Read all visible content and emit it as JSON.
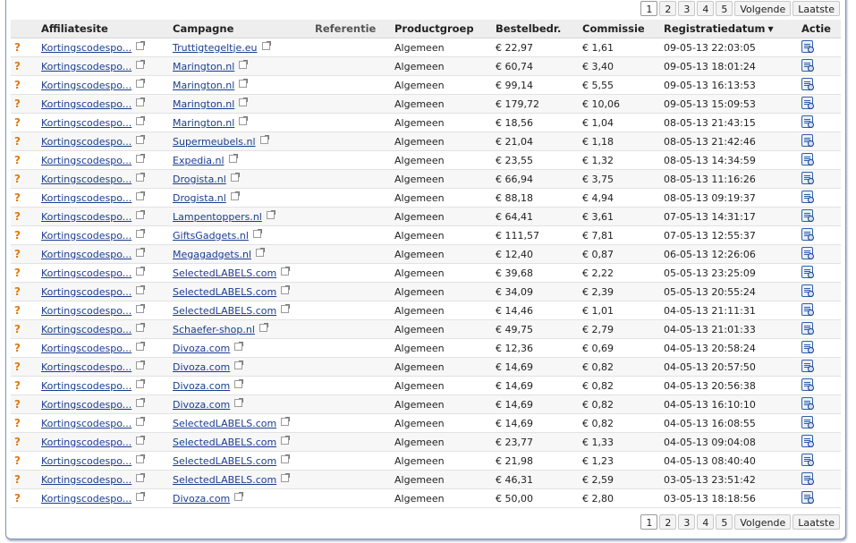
{
  "pager": {
    "pages": [
      "1",
      "2",
      "3",
      "4",
      "5"
    ],
    "active": "1",
    "next_label": "Volgende",
    "last_label": "Laatste"
  },
  "columns": {
    "affiliatesite": "Affiliatesite",
    "campagne": "Campagne",
    "referentie": "Referentie",
    "productgroep": "Productgroep",
    "bestelbedrag": "Bestelbedr.",
    "commissie": "Commissie",
    "registratiedatum": "Registratiedatum",
    "actie": "Actie"
  },
  "status_icon": "?",
  "rows": [
    {
      "site": "Kortingscodespo...",
      "campagne": "Truttigtegeltje.eu",
      "referentie": "",
      "productgroep": "Algemeen",
      "bedrag": "€ 22,97",
      "commissie": "€ 1,61",
      "datum": "09-05-13 22:03:05"
    },
    {
      "site": "Kortingscodespo...",
      "campagne": "Marington.nl",
      "referentie": "",
      "productgroep": "Algemeen",
      "bedrag": "€ 60,74",
      "commissie": "€ 3,40",
      "datum": "09-05-13 18:01:24"
    },
    {
      "site": "Kortingscodespo...",
      "campagne": "Marington.nl",
      "referentie": "",
      "productgroep": "Algemeen",
      "bedrag": "€ 99,14",
      "commissie": "€ 5,55",
      "datum": "09-05-13 16:13:53"
    },
    {
      "site": "Kortingscodespo...",
      "campagne": "Marington.nl",
      "referentie": "",
      "productgroep": "Algemeen",
      "bedrag": "€ 179,72",
      "commissie": "€ 10,06",
      "datum": "09-05-13 15:09:53"
    },
    {
      "site": "Kortingscodespo...",
      "campagne": "Marington.nl",
      "referentie": "",
      "productgroep": "Algemeen",
      "bedrag": "€ 18,56",
      "commissie": "€ 1,04",
      "datum": "08-05-13 21:43:15"
    },
    {
      "site": "Kortingscodespo...",
      "campagne": "Supermeubels.nl",
      "referentie": "",
      "productgroep": "Algemeen",
      "bedrag": "€ 21,04",
      "commissie": "€ 1,18",
      "datum": "08-05-13 21:42:46"
    },
    {
      "site": "Kortingscodespo...",
      "campagne": "Expedia.nl",
      "referentie": "",
      "productgroep": "Algemeen",
      "bedrag": "€ 23,55",
      "commissie": "€ 1,32",
      "datum": "08-05-13 14:34:59"
    },
    {
      "site": "Kortingscodespo...",
      "campagne": "Drogista.nl",
      "referentie": "",
      "productgroep": "Algemeen",
      "bedrag": "€ 66,94",
      "commissie": "€ 3,75",
      "datum": "08-05-13 11:16:26"
    },
    {
      "site": "Kortingscodespo...",
      "campagne": "Drogista.nl",
      "referentie": "",
      "productgroep": "Algemeen",
      "bedrag": "€ 88,18",
      "commissie": "€ 4,94",
      "datum": "08-05-13 09:19:37"
    },
    {
      "site": "Kortingscodespo...",
      "campagne": "Lampentoppers.nl",
      "referentie": "",
      "productgroep": "Algemeen",
      "bedrag": "€ 64,41",
      "commissie": "€ 3,61",
      "datum": "07-05-13 14:31:17"
    },
    {
      "site": "Kortingscodespo...",
      "campagne": "GiftsGadgets.nl",
      "referentie": "",
      "productgroep": "Algemeen",
      "bedrag": "€ 111,57",
      "commissie": "€ 7,81",
      "datum": "07-05-13 12:55:37"
    },
    {
      "site": "Kortingscodespo...",
      "campagne": "Megagadgets.nl",
      "referentie": "",
      "productgroep": "Algemeen",
      "bedrag": "€ 12,40",
      "commissie": "€ 0,87",
      "datum": "06-05-13 12:26:06"
    },
    {
      "site": "Kortingscodespo...",
      "campagne": "SelectedLABELS.com",
      "referentie": "",
      "productgroep": "Algemeen",
      "bedrag": "€ 39,68",
      "commissie": "€ 2,22",
      "datum": "05-05-13 23:25:09"
    },
    {
      "site": "Kortingscodespo...",
      "campagne": "SelectedLABELS.com",
      "referentie": "",
      "productgroep": "Algemeen",
      "bedrag": "€ 34,09",
      "commissie": "€ 2,39",
      "datum": "05-05-13 20:55:24"
    },
    {
      "site": "Kortingscodespo...",
      "campagne": "SelectedLABELS.com",
      "referentie": "",
      "productgroep": "Algemeen",
      "bedrag": "€ 14,46",
      "commissie": "€ 1,01",
      "datum": "04-05-13 21:11:31"
    },
    {
      "site": "Kortingscodespo...",
      "campagne": "Schaefer-shop.nl",
      "referentie": "",
      "productgroep": "Algemeen",
      "bedrag": "€ 49,75",
      "commissie": "€ 2,79",
      "datum": "04-05-13 21:01:33"
    },
    {
      "site": "Kortingscodespo...",
      "campagne": "Divoza.com",
      "referentie": "",
      "productgroep": "Algemeen",
      "bedrag": "€ 12,36",
      "commissie": "€ 0,69",
      "datum": "04-05-13 20:58:24"
    },
    {
      "site": "Kortingscodespo...",
      "campagne": "Divoza.com",
      "referentie": "",
      "productgroep": "Algemeen",
      "bedrag": "€ 14,69",
      "commissie": "€ 0,82",
      "datum": "04-05-13 20:57:50"
    },
    {
      "site": "Kortingscodespo...",
      "campagne": "Divoza.com",
      "referentie": "",
      "productgroep": "Algemeen",
      "bedrag": "€ 14,69",
      "commissie": "€ 0,82",
      "datum": "04-05-13 20:56:38"
    },
    {
      "site": "Kortingscodespo...",
      "campagne": "Divoza.com",
      "referentie": "",
      "productgroep": "Algemeen",
      "bedrag": "€ 14,69",
      "commissie": "€ 0,82",
      "datum": "04-05-13 16:10:10"
    },
    {
      "site": "Kortingscodespo...",
      "campagne": "SelectedLABELS.com",
      "referentie": "",
      "productgroep": "Algemeen",
      "bedrag": "€ 14,69",
      "commissie": "€ 0,82",
      "datum": "04-05-13 16:08:55"
    },
    {
      "site": "Kortingscodespo...",
      "campagne": "SelectedLABELS.com",
      "referentie": "",
      "productgroep": "Algemeen",
      "bedrag": "€ 23,77",
      "commissie": "€ 1,33",
      "datum": "04-05-13 09:04:08"
    },
    {
      "site": "Kortingscodespo...",
      "campagne": "SelectedLABELS.com",
      "referentie": "",
      "productgroep": "Algemeen",
      "bedrag": "€ 21,98",
      "commissie": "€ 1,23",
      "datum": "04-05-13 08:40:40"
    },
    {
      "site": "Kortingscodespo...",
      "campagne": "SelectedLABELS.com",
      "referentie": "",
      "productgroep": "Algemeen",
      "bedrag": "€ 46,31",
      "commissie": "€ 2,59",
      "datum": "03-05-13 23:51:42"
    },
    {
      "site": "Kortingscodespo...",
      "campagne": "Divoza.com",
      "referentie": "",
      "productgroep": "Algemeen",
      "bedrag": "€ 50,00",
      "commissie": "€ 2,80",
      "datum": "03-05-13 18:18:56"
    }
  ]
}
